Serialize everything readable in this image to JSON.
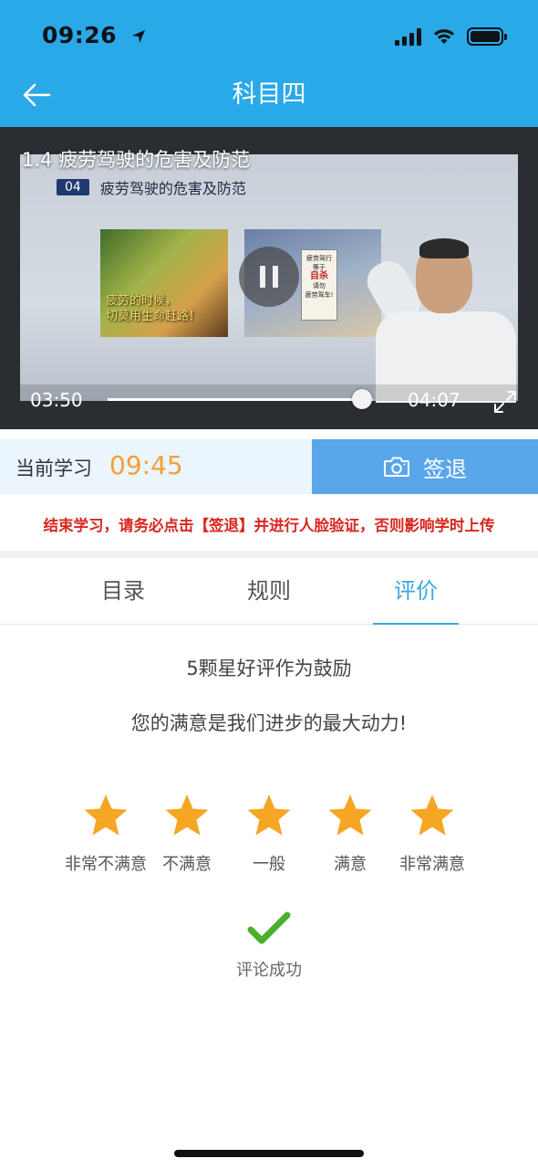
{
  "status_bar": {
    "time": "09:26"
  },
  "header": {
    "title": "科目四"
  },
  "video": {
    "caption": "1.4 疲劳驾驶的危害及防范",
    "slide": {
      "number": "04",
      "title": "疲劳驾驶的危害及防范",
      "image_caption": "疲劳的时候，\n切莫用生命赶路！",
      "note_lines": [
        "疲劳驾行",
        "等于",
        "自杀",
        "请勿",
        "疲劳驾车!"
      ]
    },
    "current_time": "03:50",
    "total_time": "04:07",
    "progress": 0.955
  },
  "study": {
    "label": "当前学习",
    "timer": "09:45",
    "signout_label": "签退"
  },
  "warning": "结束学习，请务必点击【签退】并进行人脸验证，否则影响学时上传",
  "tabs": [
    {
      "label": "目录",
      "active": false
    },
    {
      "label": "规则",
      "active": false
    },
    {
      "label": "评价",
      "active": true
    }
  ],
  "rating": {
    "headline": "5颗星好评作为鼓励",
    "subline": "您的满意是我们进步的最大动力!",
    "options": [
      "非常不满意",
      "不满意",
      "一般",
      "满意",
      "非常满意"
    ],
    "selected_stars": 5,
    "star_color": "#f5a623",
    "success_text": "评论成功",
    "success_color": "#4caf2a"
  },
  "colors": {
    "header_bg": "#29a9e8",
    "accent": "#39a8e0",
    "timer": "#f2a03a",
    "warning": "#d8261f",
    "signout_bg": "#5aa6ea"
  }
}
